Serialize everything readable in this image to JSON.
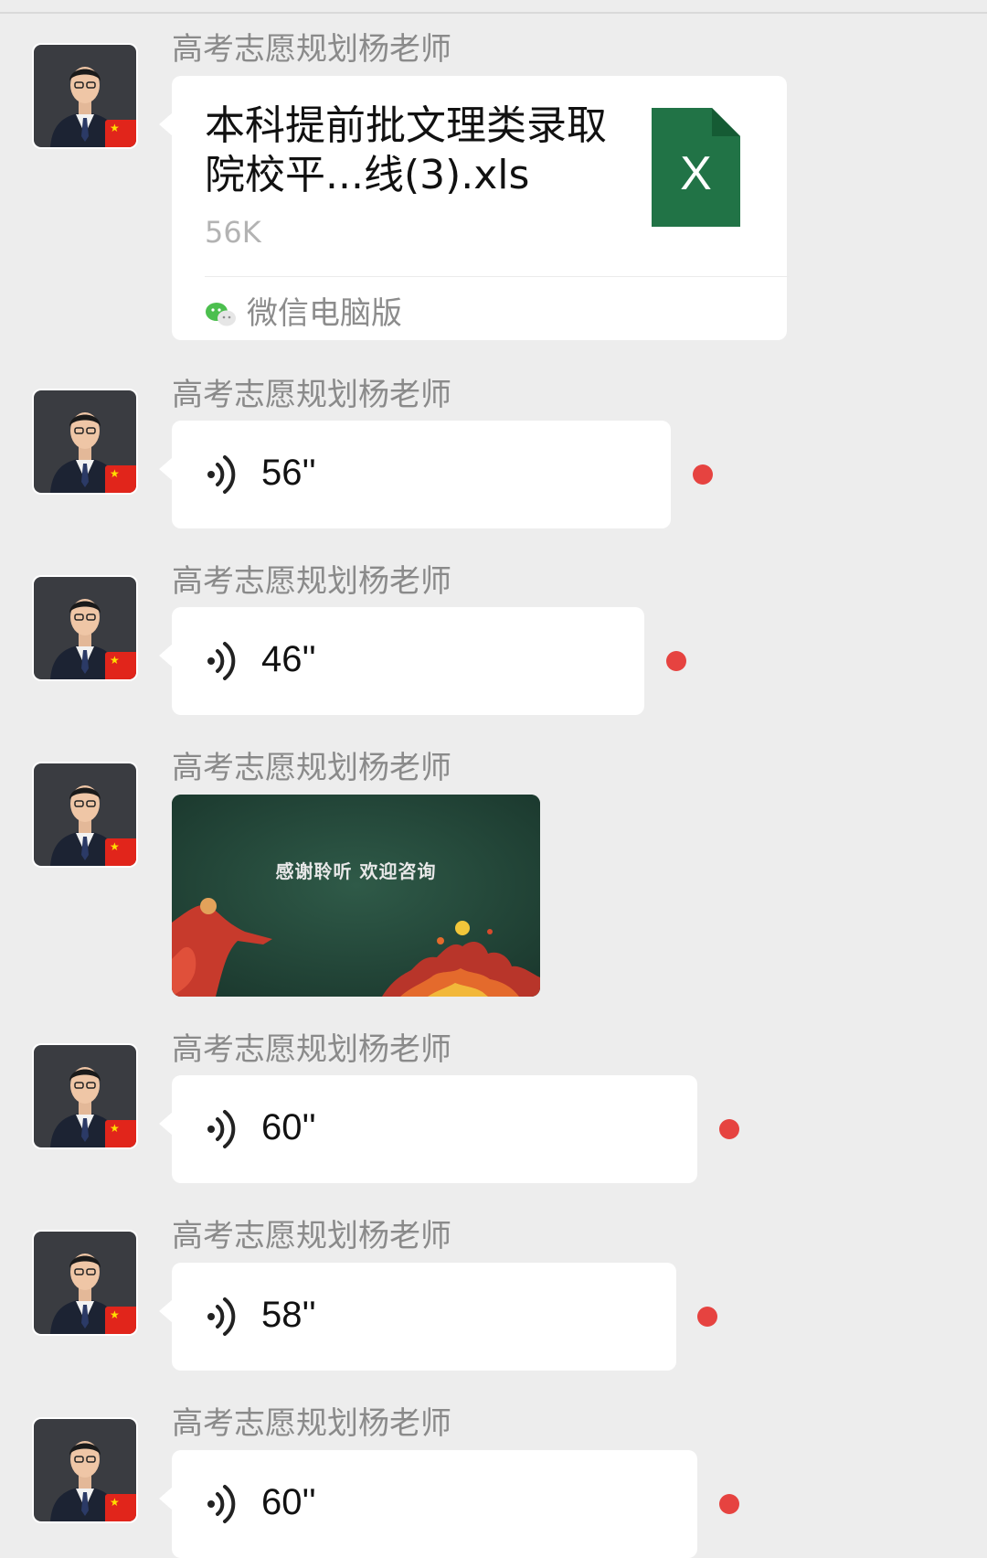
{
  "sender_name": "高考志愿规划杨老师",
  "avatar": {
    "icon": "teacher-avatar",
    "badge": "china-flag-icon",
    "badge_glyph": "★"
  },
  "messages": [
    {
      "type": "file",
      "file": {
        "name": "本科提前批文理类录取院校平...线(3).xls",
        "size": "56K",
        "icon": "excel-file-icon",
        "icon_letter": "X",
        "icon_color": "#217346",
        "source_icon": "wechat-icon",
        "source_label": "微信电脑版"
      }
    },
    {
      "type": "voice",
      "duration": "56''",
      "unread": true
    },
    {
      "type": "voice",
      "duration": "46''",
      "unread": true
    },
    {
      "type": "image",
      "image": {
        "caption": "感谢聆听  欢迎咨询",
        "background": "#25463a"
      }
    },
    {
      "type": "voice",
      "duration": "60''",
      "unread": true
    },
    {
      "type": "voice",
      "duration": "58''",
      "unread": true
    },
    {
      "type": "voice",
      "duration": "60''",
      "unread": true
    }
  ],
  "colors": {
    "background": "#ededed",
    "bubble": "#ffffff",
    "unread_dot": "#e64340",
    "sender_text": "#8a8a8a"
  }
}
